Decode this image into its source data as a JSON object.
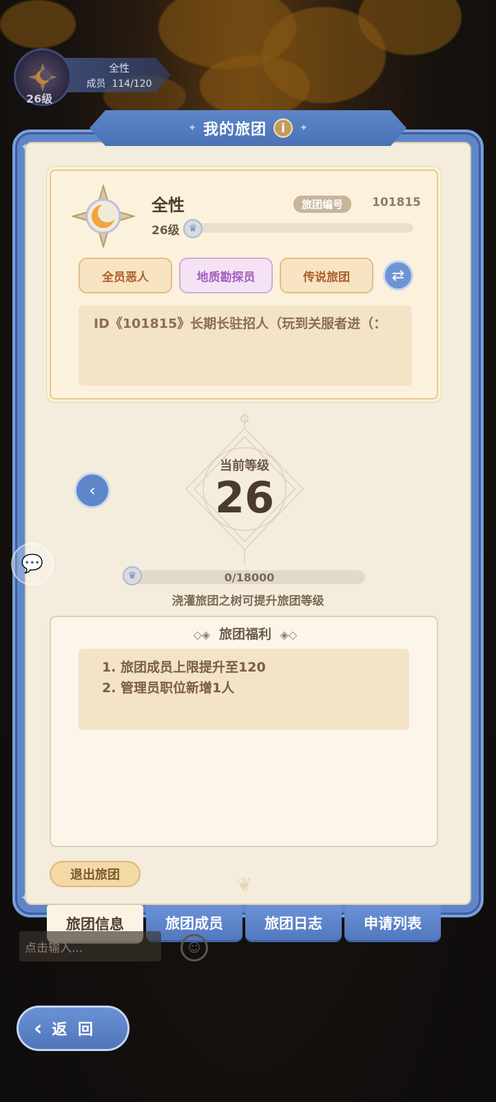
{
  "mini_guild": {
    "name": "全性",
    "members_label": "成员",
    "members_count": "114/120",
    "level": "26级"
  },
  "panel": {
    "title": "我的旅团",
    "info_icon": "info-icon"
  },
  "guild": {
    "name": "全性",
    "id_label": "旅团编号",
    "id_value": "101815",
    "level_label": "26级",
    "level_progress": 0.0,
    "tags": [
      "全员恶人",
      "地质勘探员",
      "传说旅团"
    ],
    "slogan": "ID《101815》长期长驻招人（玩到关服者进（："
  },
  "level_display": {
    "label": "当前等级",
    "value": "26"
  },
  "exp": {
    "text": "0/18000",
    "progress": 0.0,
    "hint": "浇灌旅团之树可提升旅团等级"
  },
  "benefits": {
    "title": "旅团福利",
    "items": [
      "1.  旅团成员上限提升至120",
      "2.  管理员职位新增1人"
    ]
  },
  "quit_label": "退出旅团",
  "tabs": [
    "旅团信息",
    "旅团成员",
    "旅团日志",
    "申请列表"
  ],
  "active_tab": 0,
  "chat": {
    "placeholder": "点击输入..."
  },
  "back_label": "返 回",
  "colors": {
    "accent_blue": "#5f86c9",
    "card_bg": "#fbf1dc",
    "tag_orange": "#a8612b",
    "tag_purple": "#a45ec0"
  }
}
